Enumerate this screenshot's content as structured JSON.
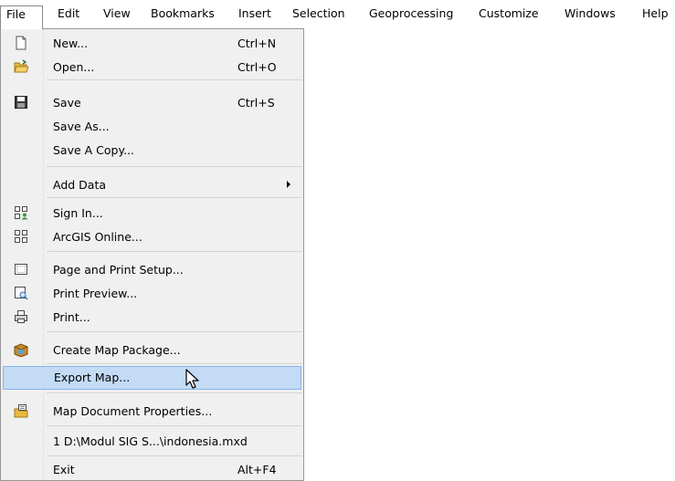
{
  "menubar": {
    "items": [
      {
        "label": "File"
      },
      {
        "label": "Edit"
      },
      {
        "label": "View"
      },
      {
        "label": "Bookmarks"
      },
      {
        "label": "Insert"
      },
      {
        "label": "Selection"
      },
      {
        "label": "Geoprocessing"
      },
      {
        "label": "Customize"
      },
      {
        "label": "Windows"
      },
      {
        "label": "Help"
      }
    ]
  },
  "file_menu": {
    "items": [
      {
        "label": "New...",
        "shortcut": "Ctrl+N",
        "icon": "new-document-icon"
      },
      {
        "label": "Open...",
        "shortcut": "Ctrl+O",
        "icon": "open-folder-icon"
      },
      {
        "label": "Save",
        "shortcut": "Ctrl+S",
        "icon": "save-disk-icon"
      },
      {
        "label": "Save As...",
        "shortcut": "",
        "icon": ""
      },
      {
        "label": "Save A Copy...",
        "shortcut": "",
        "icon": ""
      },
      {
        "label": "Add Data",
        "shortcut": "",
        "icon": "",
        "submenu": true
      },
      {
        "label": "Sign In...",
        "shortcut": "",
        "icon": "sign-in-icon"
      },
      {
        "label": "ArcGIS Online...",
        "shortcut": "",
        "icon": "arcgis-online-icon"
      },
      {
        "label": "Page and Print Setup...",
        "shortcut": "",
        "icon": "page-setup-icon"
      },
      {
        "label": "Print Preview...",
        "shortcut": "",
        "icon": "print-preview-icon"
      },
      {
        "label": "Print...",
        "shortcut": "",
        "icon": "printer-icon"
      },
      {
        "label": "Create Map Package...",
        "shortcut": "",
        "icon": "map-package-icon"
      },
      {
        "label": "Export Map...",
        "shortcut": "",
        "icon": "",
        "highlighted": true
      },
      {
        "label": "Map Document Properties...",
        "shortcut": "",
        "icon": "document-properties-icon"
      },
      {
        "label": "1 D:\\Modul SIG S...\\indonesia.mxd",
        "shortcut": "",
        "icon": ""
      },
      {
        "label": "Exit",
        "shortcut": "Alt+F4",
        "icon": ""
      }
    ]
  },
  "colors": {
    "highlight_fill": "#c3dbf5",
    "highlight_border": "#85b2e8",
    "menu_background": "#f0f0f0"
  }
}
